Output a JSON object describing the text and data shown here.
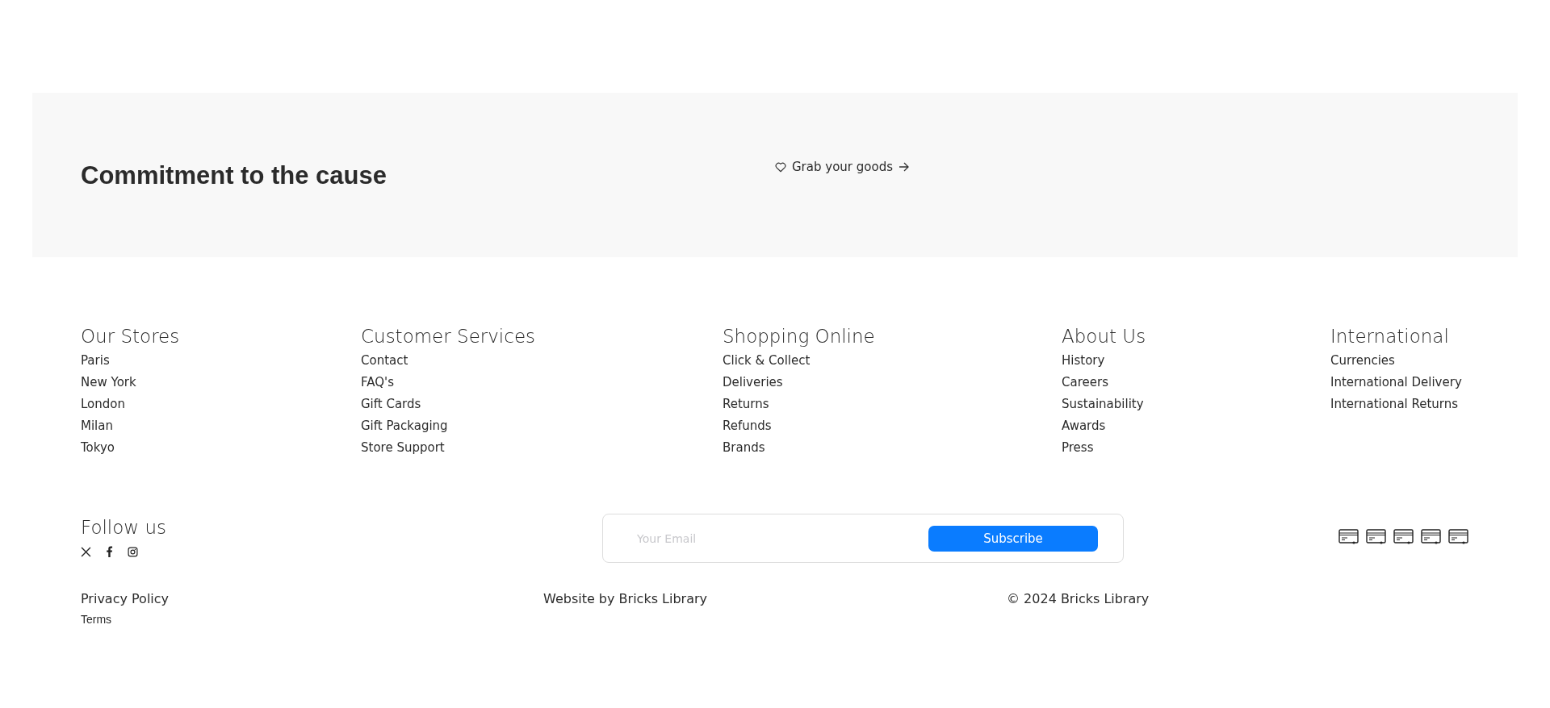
{
  "banner": {
    "title": "Commitment to the cause",
    "link": "Grab your goods"
  },
  "columns": [
    {
      "heading": "Our Stores",
      "links": [
        "Paris",
        "New York",
        "London",
        "Milan",
        "Tokyo"
      ]
    },
    {
      "heading": "Customer Services",
      "links": [
        "Contact",
        "FAQ's",
        "Gift Cards",
        "Gift Packaging",
        "Store Support"
      ]
    },
    {
      "heading": "Shopping Online",
      "links": [
        "Click & Collect",
        "Deliveries",
        "Returns",
        "Refunds",
        "Brands"
      ]
    },
    {
      "heading": "About Us",
      "links": [
        "History",
        "Careers",
        "Sustainability",
        "Awards",
        "Press"
      ]
    },
    {
      "heading": "International",
      "links": [
        "Currencies",
        "International Delivery",
        "International Returns"
      ]
    }
  ],
  "follow": {
    "heading": "Follow us"
  },
  "newsletter": {
    "placeholder": "Your Email",
    "button": "Subscribe"
  },
  "bottom": {
    "privacy": "Privacy Policy",
    "terms": "Terms",
    "credit": "Website by Bricks Library",
    "copyright": "© 2024 Bricks Library"
  }
}
